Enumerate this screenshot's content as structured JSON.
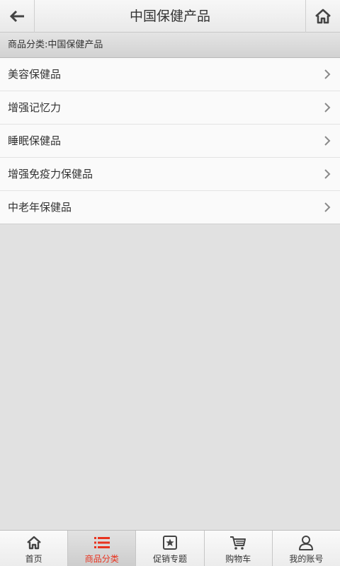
{
  "header": {
    "title": "中国保健产品",
    "back_icon": "back-arrow-icon",
    "home_icon": "home-icon"
  },
  "breadcrumb": "商品分类:中国保健产品",
  "categories": [
    {
      "label": "美容保健品"
    },
    {
      "label": "增强记忆力"
    },
    {
      "label": "睡眠保健品"
    },
    {
      "label": "增强免疫力保健品"
    },
    {
      "label": "中老年保健品"
    }
  ],
  "tabbar": {
    "active_color": "#e8331f",
    "tabs": [
      {
        "label": "首页",
        "icon": "home-icon"
      },
      {
        "label": "商品分类",
        "icon": "list-icon",
        "active": true
      },
      {
        "label": "促销专题",
        "icon": "star-badge-icon"
      },
      {
        "label": "购物车",
        "icon": "cart-icon"
      },
      {
        "label": "我的账号",
        "icon": "user-icon"
      }
    ]
  }
}
